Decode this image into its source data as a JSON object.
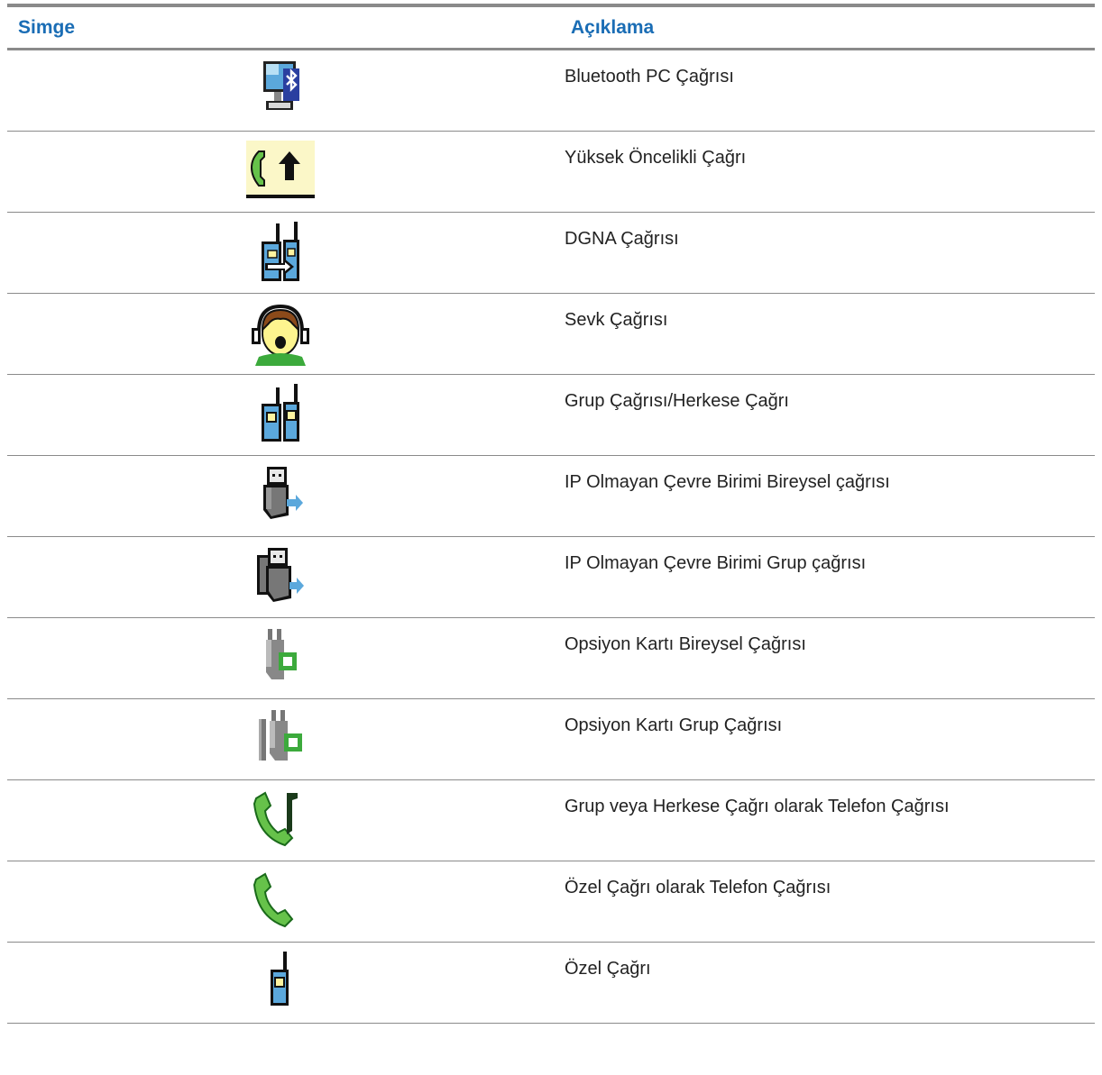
{
  "table": {
    "headers": {
      "icon": "Simge",
      "description": "Açıklama"
    },
    "rows": [
      {
        "icon": "bluetooth-pc-call-icon",
        "description": "Bluetooth PC Çağrısı"
      },
      {
        "icon": "high-priority-call-icon",
        "description": "Yüksek Öncelikli Çağrı"
      },
      {
        "icon": "dgna-call-icon",
        "description": "DGNA Çağrısı"
      },
      {
        "icon": "dispatch-call-icon",
        "description": "Sevk Çağrısı"
      },
      {
        "icon": "group-call-icon",
        "description": "Grup Çağrısı/Herkese Çağrı"
      },
      {
        "icon": "non-ip-peripheral-private-call-icon",
        "description": "IP Olmayan Çevre Birimi Bireysel çağrısı"
      },
      {
        "icon": "non-ip-peripheral-group-call-icon",
        "description": "IP Olmayan Çevre Birimi Grup çağrısı"
      },
      {
        "icon": "option-card-private-call-icon",
        "description": "Opsiyon Kartı Bireysel Çağrısı"
      },
      {
        "icon": "option-card-group-call-icon",
        "description": "Opsiyon Kartı Grup Çağrısı"
      },
      {
        "icon": "phone-call-as-group-call-icon",
        "description": "Grup veya Herkese Çağrı olarak Telefon Çağrısı"
      },
      {
        "icon": "phone-call-as-private-call-icon",
        "description": "Özel Çağrı olarak Telefon Çağrısı"
      },
      {
        "icon": "private-call-icon",
        "description": "Özel Çağrı"
      }
    ]
  }
}
